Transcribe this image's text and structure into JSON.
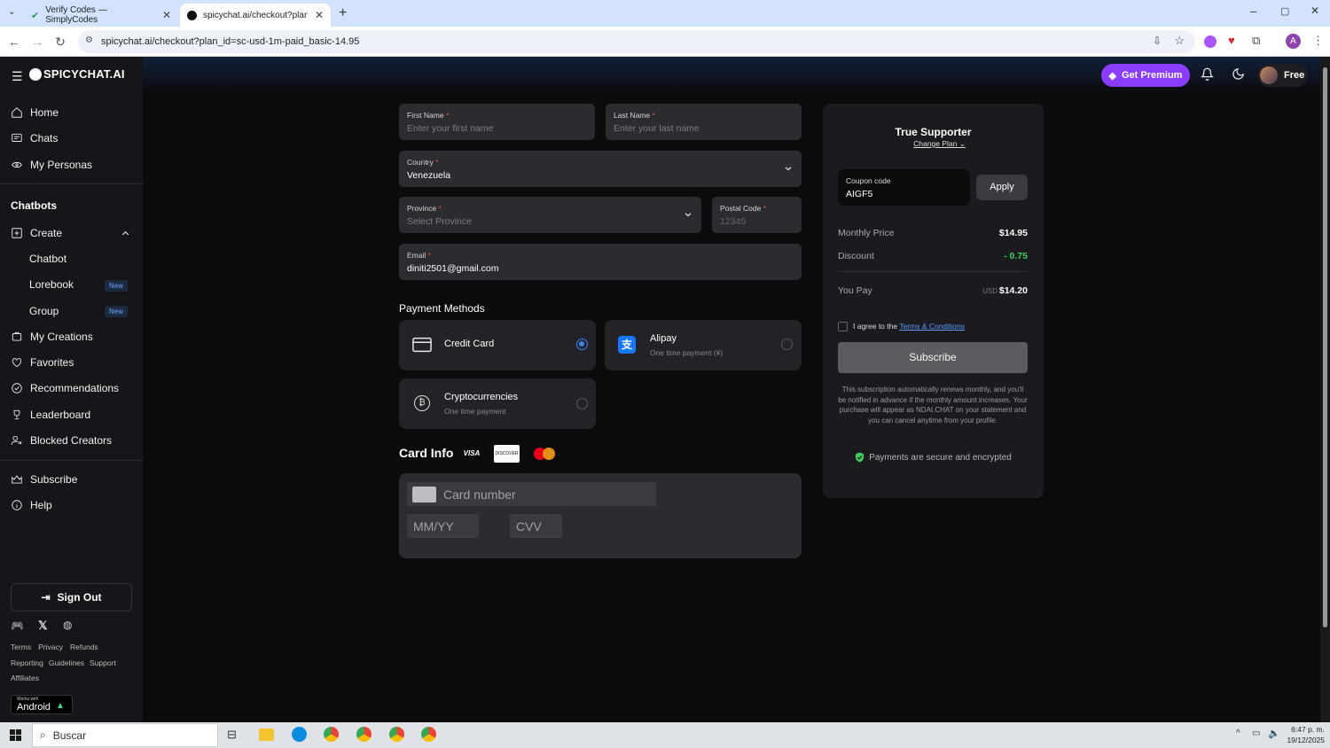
{
  "browser": {
    "tabs": [
      {
        "title": "Verify Codes — SimplyCodes"
      },
      {
        "title": "spicychat.ai/checkout?plan_id="
      }
    ],
    "url": "spicychat.ai/checkout?plan_id=sc-usd-1m-paid_basic-14.95"
  },
  "header": {
    "logo": "SPICYCHAT.AI",
    "premium_label": "Get Premium",
    "plan_label": "Free"
  },
  "sidebar": {
    "items": [
      {
        "label": "Home",
        "icon": "home-icon"
      },
      {
        "label": "Chats",
        "icon": "chat-icon"
      },
      {
        "label": "My Personas",
        "icon": "personas-icon"
      }
    ],
    "section_title": "Chatbots",
    "create_label": "Create",
    "sub_items": [
      {
        "label": "Chatbot"
      },
      {
        "label": "Lorebook",
        "badge": "New"
      },
      {
        "label": "Group",
        "badge": "New"
      }
    ],
    "items2": [
      {
        "label": "My Creations",
        "icon": "creations-icon"
      },
      {
        "label": "Favorites",
        "icon": "heart-icon"
      },
      {
        "label": "Recommendations",
        "icon": "check-circle-icon"
      },
      {
        "label": "Leaderboard",
        "icon": "trophy-icon"
      },
      {
        "label": "Blocked Creators",
        "icon": "blocked-user-icon"
      }
    ],
    "items3": [
      {
        "label": "Subscribe",
        "icon": "crown-icon"
      },
      {
        "label": "Help",
        "icon": "info-icon"
      }
    ],
    "sign_out": "Sign Out",
    "footer_links": [
      "Terms",
      "Privacy",
      "Refunds",
      "Reporting",
      "Guidelines",
      "Support",
      "Affiliates"
    ],
    "android_small": "Works with",
    "android_label": "Android"
  },
  "form": {
    "first_name": {
      "label": "First Name",
      "placeholder": "Enter your first name"
    },
    "last_name": {
      "label": "Last Name",
      "placeholder": "Enter your last name"
    },
    "country": {
      "label": "Country",
      "value": "Venezuela"
    },
    "province": {
      "label": "Province",
      "placeholder": "Select Province"
    },
    "postal": {
      "label": "Postal Code",
      "placeholder": "12345"
    },
    "email": {
      "label": "Email",
      "value": "diniti2501@gmail.com"
    },
    "required_mark": "*"
  },
  "payment": {
    "title": "Payment Methods",
    "methods": [
      {
        "name": "Credit Card",
        "sub": "",
        "selected": true
      },
      {
        "name": "Alipay",
        "sub": "One time payment (¥)",
        "selected": false
      },
      {
        "name": "Cryptocurrencies",
        "sub": "One time payment",
        "selected": false
      }
    ]
  },
  "card": {
    "title": "Card Info",
    "brands": [
      "VISA",
      "DISCOVER"
    ],
    "number_placeholder": "Card number",
    "expiry_placeholder": "MM/YY",
    "cvv_placeholder": "CVV"
  },
  "summary": {
    "plan_name": "True Supporter",
    "change_plan": "Change Plan",
    "coupon_label": "Coupon code",
    "coupon_value": "AIGF5",
    "apply_label": "Apply",
    "monthly_label": "Monthly Price",
    "monthly_value": "$14.95",
    "discount_label": "Discount",
    "discount_value": "- 0.75",
    "youpay_label": "You Pay",
    "youpay_currency": "USD",
    "youpay_value": "$14.20",
    "agree_prefix": "I agree to the",
    "agree_link": "Terms & Conditions",
    "subscribe_label": "Subscribe",
    "disclaimer": "This subscription automatically renews monthly, and you'll be notified in advance if the monthly amount increases. Your purchase will appear as NDAI.CHAT on your statement and you can cancel anytime from your profile.",
    "secure_label": "Payments are secure and encrypted",
    "accent_color": "#3b82f6",
    "discount_color": "#3ecf5a"
  },
  "taskbar": {
    "search_placeholder": "Buscar",
    "time": "6:47 p. m.",
    "date": "19/12/2025"
  },
  "profile_initial": "A"
}
